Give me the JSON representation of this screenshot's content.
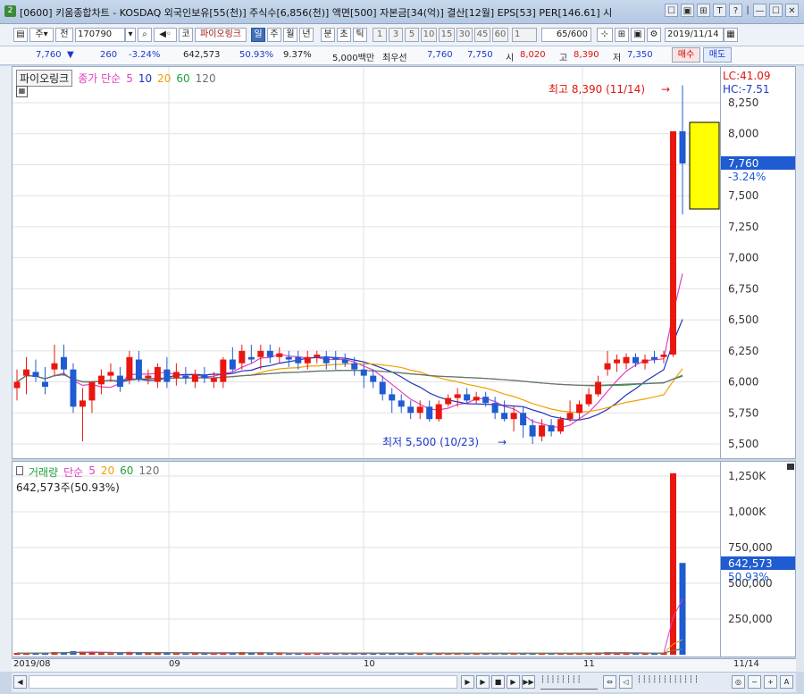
{
  "window": {
    "badge": "2",
    "title": "[0600] 키움종합차트 - KOSDAQ 외국인보유[55(천)] 주식수[6,856(천)] 액면[500] 자본금[34(억)] 결산[12월] EPS[53] PER[146.61] 시",
    "controls": [
      "☐",
      "▣",
      "⊞",
      "T",
      "?",
      "|",
      "—",
      "☐",
      "✕"
    ]
  },
  "toolbar": {
    "type_label": "주",
    "market_label": "전",
    "code_value": "170790",
    "stock_tag": "코",
    "stock_name": "파이오링크",
    "periods": [
      "일",
      "주",
      "월",
      "년",
      "분",
      "초",
      "틱"
    ],
    "active_period": "일",
    "intervals": [
      "1",
      "3",
      "5",
      "10",
      "15",
      "30",
      "45",
      "60"
    ],
    "count_value": "1",
    "range_value": "65/600",
    "date_value": "2019/11/14"
  },
  "quote": {
    "price": "7,760",
    "change_arrow": "▼",
    "change": "260",
    "change_pct": "-3.24%",
    "volume": "642,573",
    "volume_ratio": "50.93%",
    "turnover_pct": "9.37%",
    "amount": "5,000백만",
    "best_label": "최우선",
    "best_ask": "7,760",
    "best_bid": "7,750",
    "open_label": "시",
    "open": "8,020",
    "high_label": "고",
    "high": "8,390",
    "low_label": "저",
    "low": "7,350",
    "buy_label": "매수",
    "sell_label": "매도"
  },
  "price_panel": {
    "stock_tag": "파이오링크",
    "ma_label": "종가 단순",
    "ma_periods": [
      "5",
      "10",
      "20",
      "60",
      "120"
    ],
    "ma_colors": [
      "#e040c0",
      "#2030c0",
      "#f0a000",
      "#20a040",
      "#707070"
    ],
    "high_annotation": "최고 8,390 (11/14)",
    "low_annotation": "최저 5,500 (10/23)",
    "lc_label": "LC:41.09",
    "hc_label": "HC:-7.51",
    "current_price": "7,760",
    "current_change": "-3.24%"
  },
  "volume_panel": {
    "label": "거래량",
    "ma_label": "단순",
    "ma_periods": [
      "5",
      "20",
      "60",
      "120"
    ],
    "ma_colors": [
      "#e040c0",
      "#f0a000",
      "#20a040",
      "#707070"
    ],
    "current_volume_text": "642,573주(50.93%)",
    "current_volume": "642,573",
    "current_ratio": "50.93%"
  },
  "colors": {
    "up": "#e8170f",
    "down": "#1f5bd1",
    "highlight_box": "#ffff00",
    "axis_tag": "#1f5bd1"
  },
  "chart_data": {
    "type": "candlestick",
    "price_axis_ticks": [
      "8,250",
      "8,000",
      "7,750",
      "7,500",
      "7,250",
      "7,000",
      "6,750",
      "6,500",
      "6,250",
      "6,000",
      "5,750",
      "5,500"
    ],
    "volume_axis_ticks": [
      "1,250K",
      "1,000K",
      "750,000",
      "500,000",
      "250,000"
    ],
    "date_labels": [
      "2019/08",
      "09",
      "10",
      "11",
      "11/14"
    ],
    "candles": [
      {
        "o": 5950,
        "h": 6100,
        "l": 5850,
        "c": 6000
      },
      {
        "o": 6050,
        "h": 6200,
        "l": 5900,
        "c": 6100
      },
      {
        "o": 6080,
        "h": 6180,
        "l": 6000,
        "c": 6040
      },
      {
        "o": 6000,
        "h": 6120,
        "l": 5900,
        "c": 5960
      },
      {
        "o": 6100,
        "h": 6300,
        "l": 6050,
        "c": 6150
      },
      {
        "o": 6200,
        "h": 6300,
        "l": 6050,
        "c": 6100
      },
      {
        "o": 6100,
        "h": 6150,
        "l": 5750,
        "c": 5800
      },
      {
        "o": 5800,
        "h": 5950,
        "l": 5520,
        "c": 5850
      },
      {
        "o": 5850,
        "h": 6000,
        "l": 5750,
        "c": 6000
      },
      {
        "o": 5980,
        "h": 6100,
        "l": 5900,
        "c": 6050
      },
      {
        "o": 6050,
        "h": 6150,
        "l": 6000,
        "c": 6080
      },
      {
        "o": 6050,
        "h": 6120,
        "l": 5920,
        "c": 5960
      },
      {
        "o": 6020,
        "h": 6250,
        "l": 5980,
        "c": 6200
      },
      {
        "o": 6180,
        "h": 6250,
        "l": 6000,
        "c": 6020
      },
      {
        "o": 6030,
        "h": 6100,
        "l": 5980,
        "c": 6050
      },
      {
        "o": 6000,
        "h": 6150,
        "l": 5950,
        "c": 6120
      },
      {
        "o": 6100,
        "h": 6200,
        "l": 5950,
        "c": 6000
      },
      {
        "o": 6030,
        "h": 6150,
        "l": 5970,
        "c": 6080
      },
      {
        "o": 6050,
        "h": 6120,
        "l": 5980,
        "c": 6030
      },
      {
        "o": 6000,
        "h": 6100,
        "l": 5950,
        "c": 6060
      },
      {
        "o": 6060,
        "h": 6120,
        "l": 5990,
        "c": 6030
      },
      {
        "o": 6000,
        "h": 6080,
        "l": 5950,
        "c": 6030
      },
      {
        "o": 6000,
        "h": 6200,
        "l": 5950,
        "c": 6180
      },
      {
        "o": 6180,
        "h": 6280,
        "l": 6080,
        "c": 6100
      },
      {
        "o": 6150,
        "h": 6300,
        "l": 6100,
        "c": 6250
      },
      {
        "o": 6200,
        "h": 6300,
        "l": 6150,
        "c": 6180
      },
      {
        "o": 6200,
        "h": 6300,
        "l": 6100,
        "c": 6250
      },
      {
        "o": 6250,
        "h": 6300,
        "l": 6150,
        "c": 6200
      },
      {
        "o": 6200,
        "h": 6280,
        "l": 6150,
        "c": 6230
      },
      {
        "o": 6200,
        "h": 6250,
        "l": 6120,
        "c": 6180
      },
      {
        "o": 6200,
        "h": 6250,
        "l": 6100,
        "c": 6150
      },
      {
        "o": 6150,
        "h": 6250,
        "l": 6100,
        "c": 6200
      },
      {
        "o": 6200,
        "h": 6250,
        "l": 6150,
        "c": 6220
      },
      {
        "o": 6200,
        "h": 6250,
        "l": 6100,
        "c": 6150
      },
      {
        "o": 6200,
        "h": 6250,
        "l": 6100,
        "c": 6180
      },
      {
        "o": 6180,
        "h": 6230,
        "l": 6120,
        "c": 6150
      },
      {
        "o": 6150,
        "h": 6200,
        "l": 6050,
        "c": 6100
      },
      {
        "o": 6100,
        "h": 6150,
        "l": 5950,
        "c": 6050
      },
      {
        "o": 6050,
        "h": 6100,
        "l": 5950,
        "c": 6000
      },
      {
        "o": 6000,
        "h": 6050,
        "l": 5850,
        "c": 5900
      },
      {
        "o": 5900,
        "h": 5950,
        "l": 5750,
        "c": 5850
      },
      {
        "o": 5850,
        "h": 5900,
        "l": 5750,
        "c": 5800
      },
      {
        "o": 5800,
        "h": 5850,
        "l": 5700,
        "c": 5750
      },
      {
        "o": 5750,
        "h": 5850,
        "l": 5700,
        "c": 5800
      },
      {
        "o": 5800,
        "h": 5850,
        "l": 5680,
        "c": 5700
      },
      {
        "o": 5700,
        "h": 5850,
        "l": 5680,
        "c": 5820
      },
      {
        "o": 5820,
        "h": 5900,
        "l": 5800,
        "c": 5870
      },
      {
        "o": 5870,
        "h": 5950,
        "l": 5800,
        "c": 5900
      },
      {
        "o": 5900,
        "h": 5950,
        "l": 5820,
        "c": 5850
      },
      {
        "o": 5850,
        "h": 5920,
        "l": 5820,
        "c": 5880
      },
      {
        "o": 5880,
        "h": 5920,
        "l": 5800,
        "c": 5830
      },
      {
        "o": 5830,
        "h": 5880,
        "l": 5700,
        "c": 5750
      },
      {
        "o": 5750,
        "h": 5850,
        "l": 5680,
        "c": 5700
      },
      {
        "o": 5700,
        "h": 5800,
        "l": 5600,
        "c": 5750
      },
      {
        "o": 5750,
        "h": 5800,
        "l": 5550,
        "c": 5650
      },
      {
        "o": 5650,
        "h": 5700,
        "l": 5500,
        "c": 5560
      },
      {
        "o": 5560,
        "h": 5700,
        "l": 5520,
        "c": 5650
      },
      {
        "o": 5650,
        "h": 5700,
        "l": 5560,
        "c": 5600
      },
      {
        "o": 5600,
        "h": 5720,
        "l": 5580,
        "c": 5700
      },
      {
        "o": 5700,
        "h": 5850,
        "l": 5680,
        "c": 5750
      },
      {
        "o": 5750,
        "h": 5850,
        "l": 5700,
        "c": 5820
      },
      {
        "o": 5820,
        "h": 5950,
        "l": 5800,
        "c": 5900
      },
      {
        "o": 5900,
        "h": 6050,
        "l": 5880,
        "c": 6000
      },
      {
        "o": 6100,
        "h": 6250,
        "l": 6050,
        "c": 6150
      },
      {
        "o": 6150,
        "h": 6220,
        "l": 6080,
        "c": 6180
      },
      {
        "o": 6150,
        "h": 6230,
        "l": 6100,
        "c": 6200
      },
      {
        "o": 6200,
        "h": 6230,
        "l": 6120,
        "c": 6150
      },
      {
        "o": 6150,
        "h": 6220,
        "l": 6100,
        "c": 6180
      },
      {
        "o": 6200,
        "h": 6250,
        "l": 6150,
        "c": 6180
      },
      {
        "o": 6200,
        "h": 6250,
        "l": 6150,
        "c": 6220
      },
      {
        "o": 6220,
        "h": 8020,
        "l": 6200,
        "c": 8020
      },
      {
        "o": 8020,
        "h": 8390,
        "l": 7350,
        "c": 7760
      }
    ],
    "volumes": [
      12,
      10,
      14,
      11,
      18,
      16,
      25,
      22,
      15,
      12,
      10,
      11,
      20,
      14,
      10,
      12,
      13,
      9,
      8,
      10,
      9,
      8,
      16,
      12,
      18,
      10,
      12,
      9,
      10,
      8,
      9,
      10,
      8,
      9,
      8,
      7,
      9,
      12,
      10,
      11,
      12,
      9,
      8,
      7,
      9,
      8,
      7,
      9,
      8,
      7,
      8,
      9,
      8,
      10,
      9,
      11,
      8,
      7,
      8,
      10,
      12,
      14,
      16,
      18,
      15,
      12,
      11,
      10,
      9,
      12,
      1270,
      642
    ]
  }
}
